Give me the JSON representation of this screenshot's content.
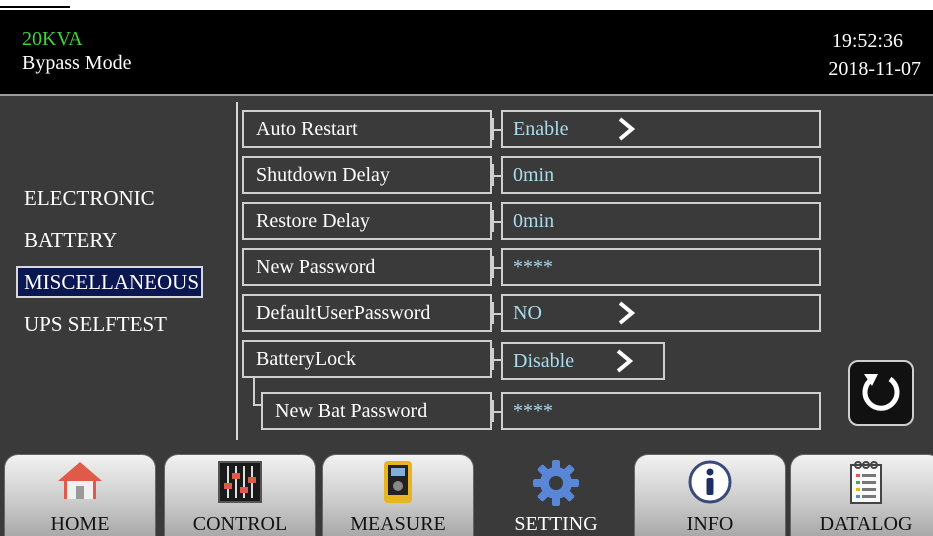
{
  "header": {
    "model": "20KVA",
    "mode": "Bypass Mode",
    "time": "19:52:36",
    "date": "2018-11-07"
  },
  "menu": {
    "items": [
      {
        "label": "ELECTRONIC"
      },
      {
        "label": "BATTERY"
      },
      {
        "label": "MISCELLANEOUS"
      },
      {
        "label": "UPS SELFTEST"
      }
    ],
    "active": "MISCELLANEOUS"
  },
  "settings": [
    {
      "label": "Auto Restart",
      "value": "Enable",
      "has_arrow": true
    },
    {
      "label": "Shutdown Delay",
      "value": "0min",
      "has_arrow": false
    },
    {
      "label": "Restore Delay",
      "value": "0min",
      "has_arrow": false
    },
    {
      "label": "New Password",
      "value": "****",
      "has_arrow": false
    },
    {
      "label": "DefaultUserPassword",
      "value": "NO",
      "has_arrow": true
    },
    {
      "label": "BatteryLock",
      "value": "Disable",
      "has_arrow": true
    },
    {
      "label": "New Bat Password",
      "value": "****",
      "has_arrow": false
    }
  ],
  "back_button": {
    "icon": "refresh-back-icon"
  },
  "nav": {
    "tabs": [
      {
        "label": "HOME",
        "icon": "house-icon"
      },
      {
        "label": "CONTROL",
        "icon": "sliders-icon"
      },
      {
        "label": "MEASURE",
        "icon": "multimeter-icon"
      },
      {
        "label": "SETTING",
        "icon": "gear-icon"
      },
      {
        "label": "INFO",
        "icon": "info-icon"
      },
      {
        "label": "DATALOG",
        "icon": "log-icon"
      }
    ],
    "active": "SETTING"
  },
  "colors": {
    "header_bg": "#000000",
    "model_text": "#3dd43d",
    "panel_bg": "#3a3a3a",
    "value_text": "#a9dcee",
    "active_menu_bg": "#0a1750"
  }
}
